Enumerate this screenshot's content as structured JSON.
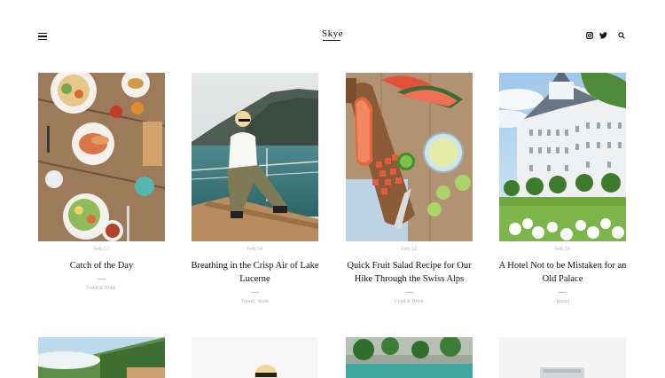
{
  "site": {
    "logo": "Skye"
  },
  "header": {
    "icons": [
      "menu-icon",
      "instagram-icon",
      "twitter-icon",
      "search-icon"
    ]
  },
  "posts": [
    {
      "date": "Feb 17",
      "title": "Catch of the Day",
      "category": "Food & Drink"
    },
    {
      "date": "Feb 14",
      "title": "Breathing in the Crisp Air of Lake Lucerne",
      "category": "Travel, Style"
    },
    {
      "date": "Feb 12",
      "title": "Quick Fruit Salad Recipe for Our Hike Through the Swiss Alps",
      "category": "Food & Drink"
    },
    {
      "date": "Feb 10",
      "title": "A Hotel Not to be Mistaken for an Old Palace",
      "category": "Travel"
    }
  ],
  "colors": {
    "text": "#111111",
    "meta": "#aaaaaa",
    "background": "#ffffff"
  }
}
